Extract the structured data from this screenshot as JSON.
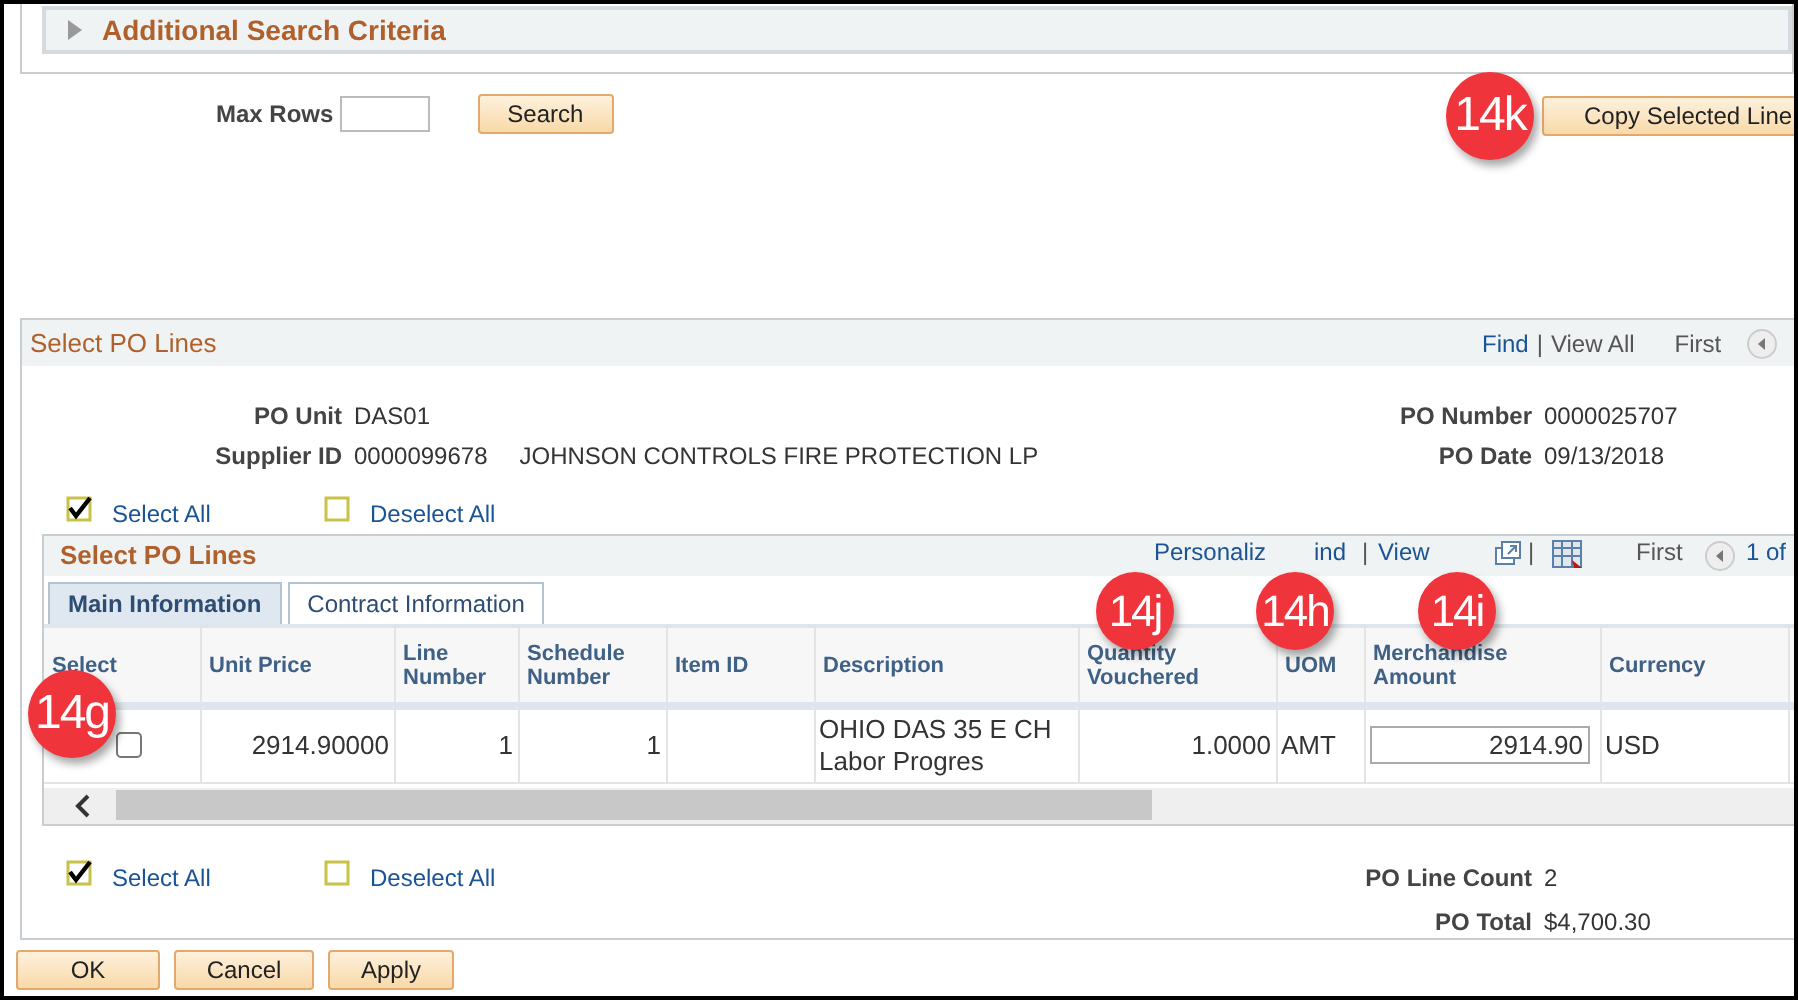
{
  "search_criteria": {
    "title": "Additional Search Criteria",
    "expanded": false
  },
  "max_rows": {
    "label": "Max Rows"
  },
  "search_button": "Search",
  "copy_button": "Copy Selected Line",
  "callouts": [
    "14k",
    "14j",
    "14h",
    "14i",
    "14g"
  ],
  "panel": {
    "title": "Select PO Lines",
    "links": [
      {
        "kind": "link",
        "text": "Find"
      },
      {
        "kind": "separator",
        "text": "|"
      },
      {
        "kind": "plain",
        "text": "View All"
      }
    ],
    "nav_first": "First",
    "fields_left": [
      {
        "label": "PO Unit",
        "value": "DAS01"
      },
      {
        "label": "Supplier ID",
        "value": "0000099678",
        "extra": "JOHNSON CONTROLS FIRE PROTECTION LP"
      }
    ],
    "fields_right": [
      {
        "label": "PO Number",
        "value": "0000025707"
      },
      {
        "label": "PO Date",
        "value": "09/13/2018"
      }
    ],
    "select_links_top": [
      {
        "label": "Select All",
        "checked": true
      },
      {
        "label": "Deselect All",
        "checked": false
      }
    ],
    "grid": {
      "title": "Select PO Lines",
      "toolbar": [
        {
          "kind": "link",
          "text": "Personaliz"
        },
        {
          "kind": "link",
          "text": "ind"
        },
        {
          "kind": "separator",
          "text": "|"
        },
        {
          "kind": "link",
          "text": "View"
        },
        {
          "kind": "separator",
          "text": "|"
        }
      ],
      "nav_first": "First",
      "nav_count": "1 of",
      "tabs": [
        {
          "label": "Main Information",
          "selected": true
        },
        {
          "label": "Contract Information",
          "selected": false
        }
      ],
      "columns": [
        {
          "label": "Select",
          "kind": "checkbox"
        },
        {
          "label": "Unit Price",
          "kind": "number"
        },
        {
          "label": "Line Number",
          "kind": "number"
        },
        {
          "label": "Schedule Number",
          "kind": "number"
        },
        {
          "label": "Item ID",
          "kind": "text"
        },
        {
          "label": "Description",
          "kind": "text"
        },
        {
          "label": "Quantity Vouchered",
          "kind": "number"
        },
        {
          "label": "UOM",
          "kind": "text"
        },
        {
          "label": "Merchandise Amount",
          "kind": "input"
        },
        {
          "label": "Currency",
          "kind": "text"
        }
      ],
      "rows": [
        {
          "selected": false,
          "cells": [
            null,
            "2914.90000",
            "1",
            "1",
            null,
            "OHIO DAS 35 E CH Labor Progres",
            "1.0000",
            "AMT",
            "2914.90",
            "USD"
          ]
        }
      ]
    },
    "select_links_bottom": [
      {
        "label": "Select All",
        "checked": true
      },
      {
        "label": "Deselect All",
        "checked": false
      }
    ],
    "totals": [
      {
        "label": "PO Line Count",
        "value": "2"
      },
      {
        "label": "PO Total",
        "value": "$4,700.30"
      }
    ]
  },
  "buttons": [
    "OK",
    "Cancel",
    "Apply"
  ]
}
